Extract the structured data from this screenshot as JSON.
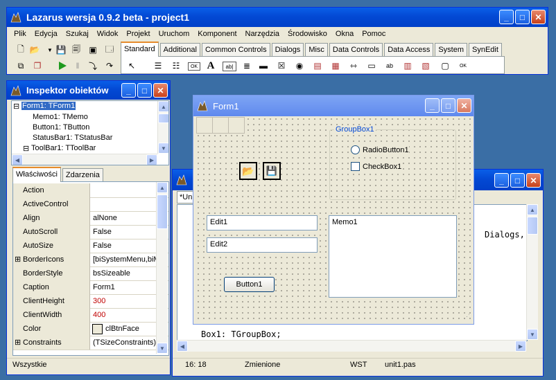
{
  "main_window": {
    "title": "Lazarus wersja 0.9.2 beta - project1",
    "menu": [
      "Plik",
      "Edycja",
      "Szukaj",
      "Widok",
      "Projekt",
      "Uruchom",
      "Komponent",
      "Narzędzia",
      "Środowisko",
      "Okna",
      "Pomoc"
    ],
    "palette_tabs": [
      "Standard",
      "Additional",
      "Common Controls",
      "Dialogs",
      "Misc",
      "Data Controls",
      "Data Access",
      "System",
      "SynEdit"
    ],
    "active_tab": "Standard",
    "run_icon_color": "#1e9a1e"
  },
  "inspector": {
    "title": "Inspektor obiektów",
    "tree": [
      "Form1: TForm1",
      "Memo1: TMemo",
      "Button1: TButton",
      "StatusBar1: TStatusBar",
      "ToolBar1: TToolBar"
    ],
    "tabs": [
      "Właściwości",
      "Zdarzenia"
    ],
    "properties": [
      {
        "name": "Action",
        "value": "",
        "expand": false
      },
      {
        "name": "ActiveControl",
        "value": "",
        "expand": false
      },
      {
        "name": "Align",
        "value": "alNone",
        "expand": false
      },
      {
        "name": "AutoScroll",
        "value": "False",
        "expand": false
      },
      {
        "name": "AutoSize",
        "value": "False",
        "expand": false
      },
      {
        "name": "BorderIcons",
        "value": "[biSystemMenu,biM",
        "expand": true
      },
      {
        "name": "BorderStyle",
        "value": "bsSizeable",
        "expand": false
      },
      {
        "name": "Caption",
        "value": "Form1",
        "expand": false
      },
      {
        "name": "ClientHeight",
        "value": "300",
        "expand": false,
        "changed": true
      },
      {
        "name": "ClientWidth",
        "value": "400",
        "expand": false,
        "changed": true
      },
      {
        "name": "Color",
        "value": "clBtnFace",
        "expand": false,
        "swatch": true
      },
      {
        "name": "Constraints",
        "value": "(TSizeConstraints)",
        "expand": true
      }
    ],
    "changed_color": "#c00000",
    "filter": "Wszystkie"
  },
  "editor": {
    "tab_label": "*Un",
    "code_fragment_right": "Dialogs,",
    "code_line_bottom": "Box1: TGroupBox;",
    "status": {
      "position": "16: 18",
      "modified": "Zmienione",
      "mode": "WST",
      "file": "unit1.pas"
    }
  },
  "form": {
    "title": "Form1",
    "groupbox_label": "GroupBox1",
    "radio_label": "RadioButton1",
    "checkbox_label": "CheckBox1",
    "edit1": "Edit1",
    "edit2": "Edit2",
    "memo": "Memo1",
    "button": "Button1"
  }
}
